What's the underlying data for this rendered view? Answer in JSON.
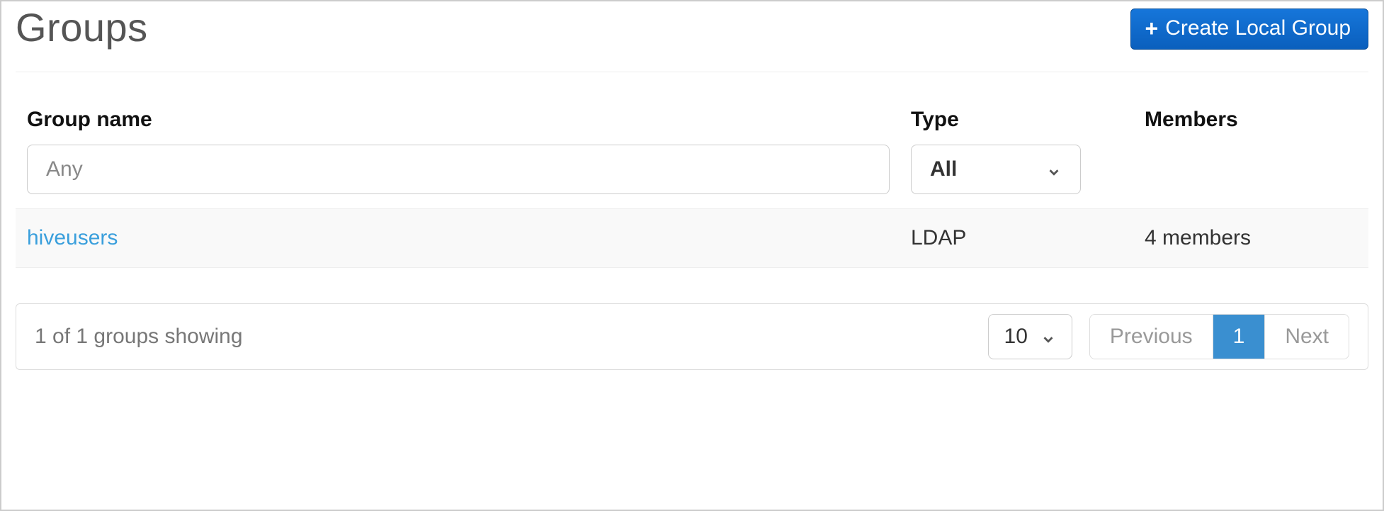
{
  "header": {
    "title": "Groups",
    "create_button": "Create Local Group"
  },
  "table": {
    "columns": {
      "name": "Group name",
      "type": "Type",
      "members": "Members"
    },
    "filters": {
      "name_placeholder": "Any",
      "type_selected": "All"
    },
    "rows": [
      {
        "name": "hiveusers",
        "type": "LDAP",
        "members": "4 members"
      }
    ]
  },
  "footer": {
    "status": "1 of 1 groups showing",
    "page_size": "10",
    "pager": {
      "prev": "Previous",
      "current": "1",
      "next": "Next"
    }
  }
}
